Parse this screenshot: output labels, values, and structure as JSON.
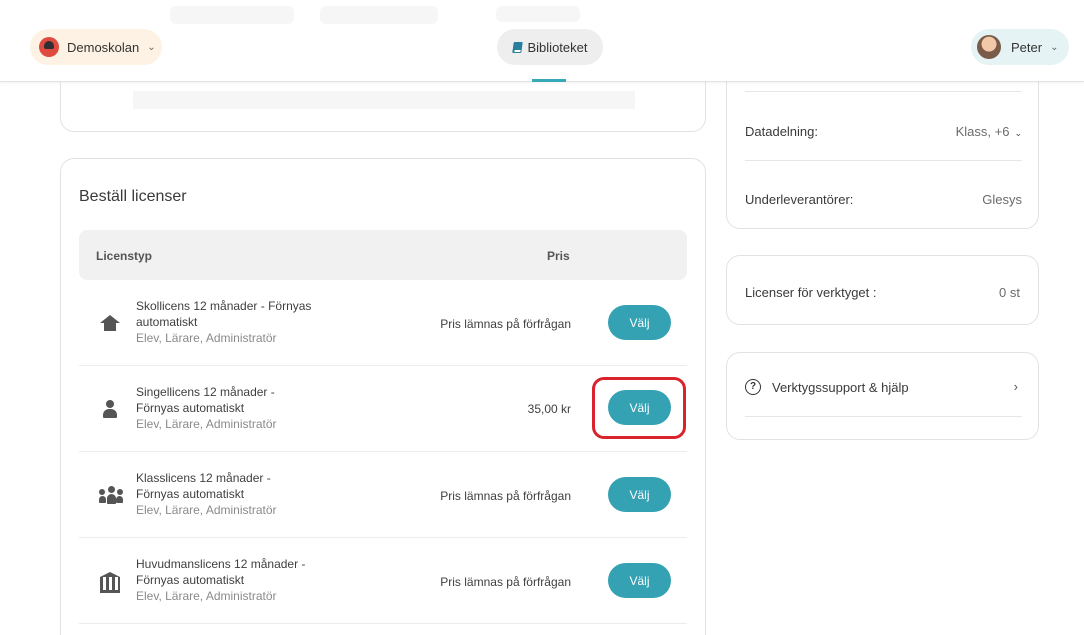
{
  "topbar": {
    "school_name": "Demoskolan",
    "library_label": "Biblioteket",
    "user_name": "Peter"
  },
  "licenses": {
    "title": "Beställ licenser",
    "header_type": "Licenstyp",
    "header_price": "Pris",
    "button_label": "Välj",
    "rows": [
      {
        "icon": "home-icon",
        "name_line1": "Skollicens 12 månader - Förnyas",
        "name_line2": "automatiskt",
        "roles": "Elev, Lärare, Administratör",
        "price": "Pris lämnas på förfrågan"
      },
      {
        "icon": "person-icon",
        "name_line1": "Singellicens 12 månader -",
        "name_line2": "Förnyas automatiskt",
        "roles": "Elev, Lärare, Administratör",
        "price": "35,00 kr"
      },
      {
        "icon": "group-icon",
        "name_line1": "Klasslicens 12 månader -",
        "name_line2": "Förnyas automatiskt",
        "roles": "Elev, Lärare, Administratör",
        "price": "Pris lämnas på förfrågan"
      },
      {
        "icon": "bank-icon",
        "name_line1": "Huvudmanslicens 12 månader -",
        "name_line2": "Förnyas automatiskt",
        "roles": "Elev, Lärare, Administratör",
        "price": "Pris lämnas på förfrågan"
      }
    ]
  },
  "info": {
    "data_sharing_label": "Datadelning:",
    "data_sharing_value": "Klass, +6",
    "subcontractors_label": "Underleverantörer:",
    "subcontractors_value": "Glesys"
  },
  "tool_licenses": {
    "label": "Licenser för verktyget :",
    "value": "0 st"
  },
  "support": {
    "label": "Verktygssupport & hjälp"
  },
  "colors": {
    "accent": "#35a2b4",
    "highlight": "#d9232d"
  }
}
